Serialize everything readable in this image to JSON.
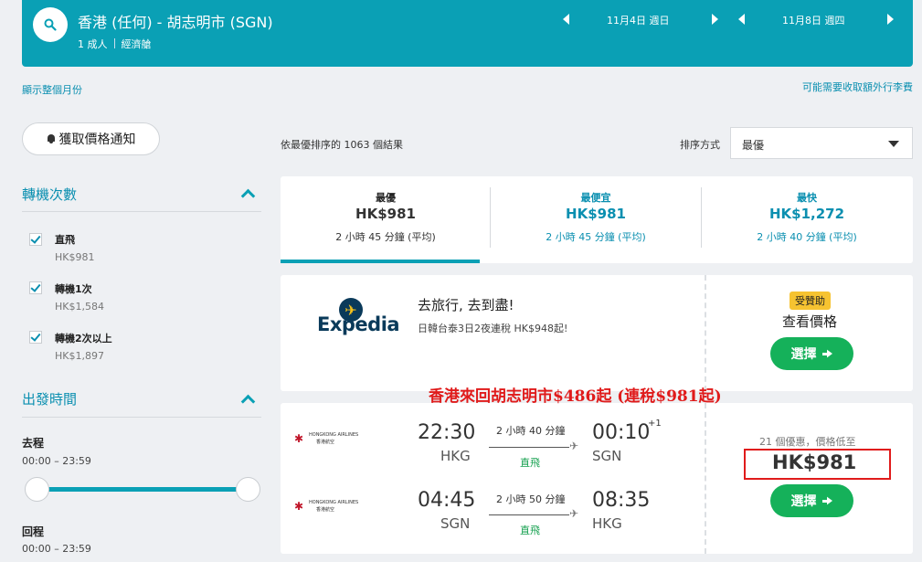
{
  "header": {
    "route": "香港 (任何) - 胡志明市 (SGN)",
    "passengers": "1 成人",
    "cabin": "經濟艙",
    "depart_date": "11月4日 週日",
    "return_date": "11月8日 週四"
  },
  "links": {
    "show_month": "顯示整個月份",
    "extra_fees": "可能需要收取額外行李費"
  },
  "sidebar": {
    "price_alert_label": "獲取價格通知",
    "stops_title": "轉機次數",
    "stops": [
      {
        "label": "直飛",
        "price": "HK$981"
      },
      {
        "label": "轉機1次",
        "price": "HK$1,584"
      },
      {
        "label": "轉機2次以上",
        "price": "HK$1,897"
      }
    ],
    "times_title": "出發時間",
    "outbound_label": "去程",
    "outbound_range": "00:00 – 23:59",
    "return_label": "回程",
    "return_range": "00:00 – 23:59"
  },
  "results": {
    "count_text": "依最優排序的 1063 個結果",
    "sort_label": "排序方式",
    "sort_value": "最優"
  },
  "tabs": [
    {
      "title": "最優",
      "price": "HK$981",
      "duration": "2 小時 45 分鐘 (平均)"
    },
    {
      "title": "最便宜",
      "price": "HK$981",
      "duration": "2 小時 45 分鐘 (平均)"
    },
    {
      "title": "最快",
      "price": "HK$1,272",
      "duration": "2 小時 40 分鐘 (平均)"
    }
  ],
  "ad": {
    "brand": "Expedia",
    "title": "去旅行, 去到盡!",
    "subtitle": "日韓台泰3日2夜連稅 HK$948起!",
    "badge": "受贊助",
    "cta_text": "查看價格",
    "select_label": "選擇"
  },
  "promo_text": "香港來回胡志明市$486起 (連稅$981起)",
  "flight": {
    "airline_en": "HONGKONG AIRLINES",
    "airline_zh": "香港航空",
    "legs": [
      {
        "dep_time": "22:30",
        "dep_code": "HKG",
        "duration": "2 小時 40 分鐘",
        "stops": "直飛",
        "arr_time": "00:10",
        "arr_code": "SGN",
        "day_offset": "+1"
      },
      {
        "dep_time": "04:45",
        "dep_code": "SGN",
        "duration": "2 小時 50 分鐘",
        "stops": "直飛",
        "arr_time": "08:35",
        "arr_code": "HKG",
        "day_offset": ""
      }
    ],
    "deals_text": "21 個優惠，價格低至",
    "price": "HK$981",
    "select_label": "選擇"
  },
  "colors": {
    "header_bg": "#0aa0b5",
    "accent": "#0a8fb0",
    "select_green": "#15b15a",
    "promo_red": "#e01b1b",
    "badge_yellow": "#f6c331"
  }
}
